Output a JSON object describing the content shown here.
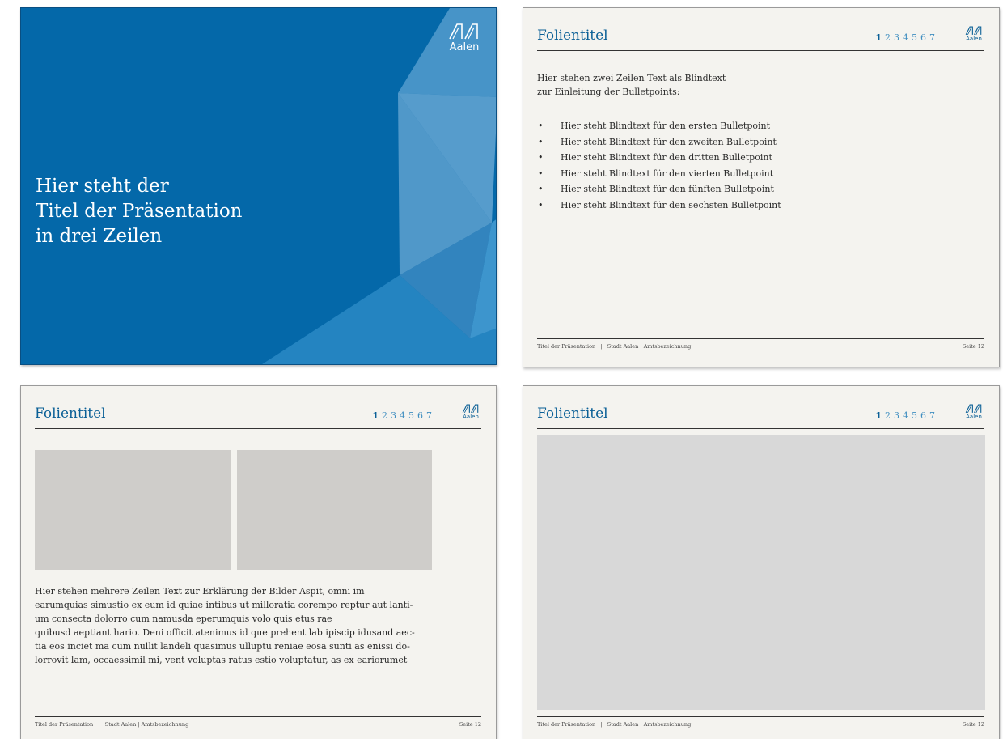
{
  "logo": {
    "word": "Aalen"
  },
  "title_slide": {
    "title_lines": [
      "Hier steht der",
      "Titel der Präsentation",
      "in drei Zeilen"
    ],
    "background_color": "#0468a9"
  },
  "slide_header": {
    "title": "Folientitel",
    "page_nav": [
      "1",
      "2",
      "3",
      "4",
      "5",
      "6",
      "7"
    ]
  },
  "bullet_slide": {
    "intro_lines": [
      "Hier stehen zwei Zeilen Text als Blindtext",
      "zur Einleitung der Bulletpoints:"
    ],
    "bullets": [
      "Hier steht Blindtext für den ersten Bulletpoint",
      "Hier steht Blindtext für den zweiten Bulletpoint",
      "Hier steht Blindtext für den dritten Bulletpoint",
      "Hier steht Blindtext für den vierten Bulletpoint",
      "Hier steht Blindtext für den fünften Bulletpoint",
      "Hier steht Blindtext für den sechsten Bulletpoint"
    ]
  },
  "image_slide": {
    "body_lines": [
      "Hier stehen mehrere Zeilen Text zur Erklärung der Bilder Aspit, omni im",
      "earumquias simustio ex eum id quiae intibus ut milloratia corempo reptur aut lanti-",
      "um consecta dolorro cum namusda eperumquis volo quis etus rae",
      "quibusd aeptiant hario. Deni officit atenimus id que prehent lab ipiscip idusand aec-",
      "tia eos inciet ma cum nullit landeli quasimus ulluptu reniae eosa sunti as enissi do-",
      "lorrovit lam, occaessimil mi, vent voluptas ratus estio voluptatur, as ex eariorumet"
    ]
  },
  "footer": {
    "left": "Titel der Präsentation   |   Stadt Aalen | Amtsbezeichnung",
    "right": "Seite 12"
  },
  "colors": {
    "brand_blue": "#0a5f96",
    "nav_blue": "#3f8ec0",
    "slide_bg": "#f4f3ef",
    "placeholder_gray": "#cfcdca"
  }
}
